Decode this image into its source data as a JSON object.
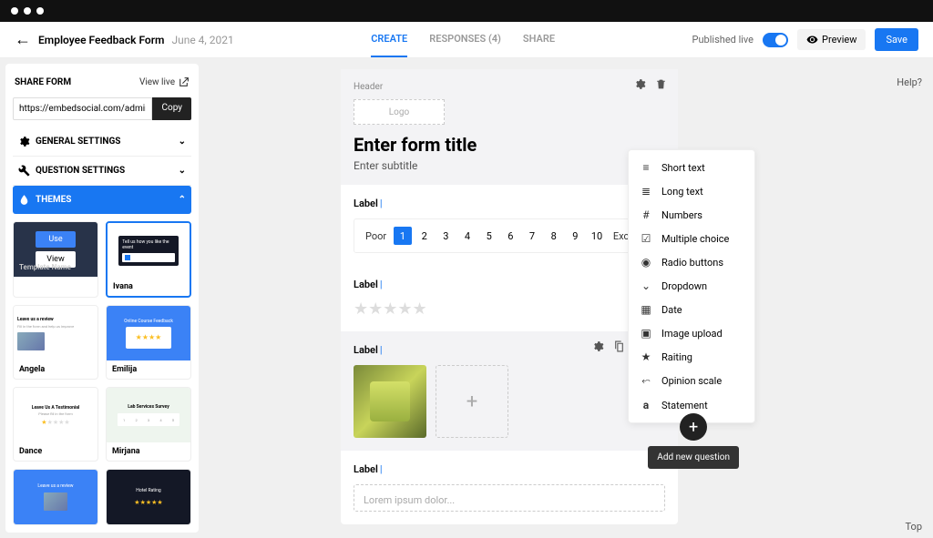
{
  "header": {
    "title": "Employee Feedback Form",
    "date": "June 4, 2021",
    "tabs": [
      "CREATE",
      "RESPONSES (4)",
      "SHARE"
    ],
    "published_label": "Published live",
    "preview": "Preview",
    "save": "Save"
  },
  "sidebar": {
    "share_title": "SHARE FORM",
    "view_live": "View live",
    "share_url": "https://embedsocial.com/admin/edit_v",
    "copy": "Copy",
    "acc": {
      "general": "GENERAL SETTINGS",
      "question": "QUESTION SETTINGS",
      "themes": "THEMES"
    },
    "actions": {
      "use": "Use",
      "view": "View",
      "template_name": "Template Name"
    },
    "themes": [
      {
        "name": "",
        "overlay": true
      },
      {
        "name": "Ivana",
        "active": true
      },
      {
        "name": "Angela"
      },
      {
        "name": "Emilija"
      },
      {
        "name": "Dance"
      },
      {
        "name": "Mirjana"
      },
      {
        "name": ""
      },
      {
        "name": ""
      }
    ]
  },
  "form": {
    "header_label": "Header",
    "logo": "Logo",
    "title": "Enter form title",
    "subtitle": "Enter subtitle",
    "label": "Label",
    "scale": {
      "left": "Poor",
      "right": "Excellent",
      "nums": [
        1,
        2,
        3,
        4,
        5,
        6,
        7,
        8,
        9,
        10
      ],
      "selected": 1
    },
    "textarea_ph": "Lorem ipsum dolor..."
  },
  "qtypes": [
    {
      "icon": "≡",
      "label": "Short text"
    },
    {
      "icon": "≣",
      "label": "Long text"
    },
    {
      "icon": "#",
      "label": "Numbers"
    },
    {
      "icon": "☑",
      "label": "Multiple choice"
    },
    {
      "icon": "◉",
      "label": "Radio buttons"
    },
    {
      "icon": "⌄",
      "label": "Dropdown"
    },
    {
      "icon": "▦",
      "label": "Date"
    },
    {
      "icon": "▣",
      "label": "Image upload"
    },
    {
      "icon": "★",
      "label": "Raiting"
    },
    {
      "icon": "⬿",
      "label": "Opinion scale"
    },
    {
      "icon": "a",
      "label": "Statement"
    }
  ],
  "fab": "Add new question",
  "links": {
    "help": "Help?",
    "top": "Top"
  }
}
